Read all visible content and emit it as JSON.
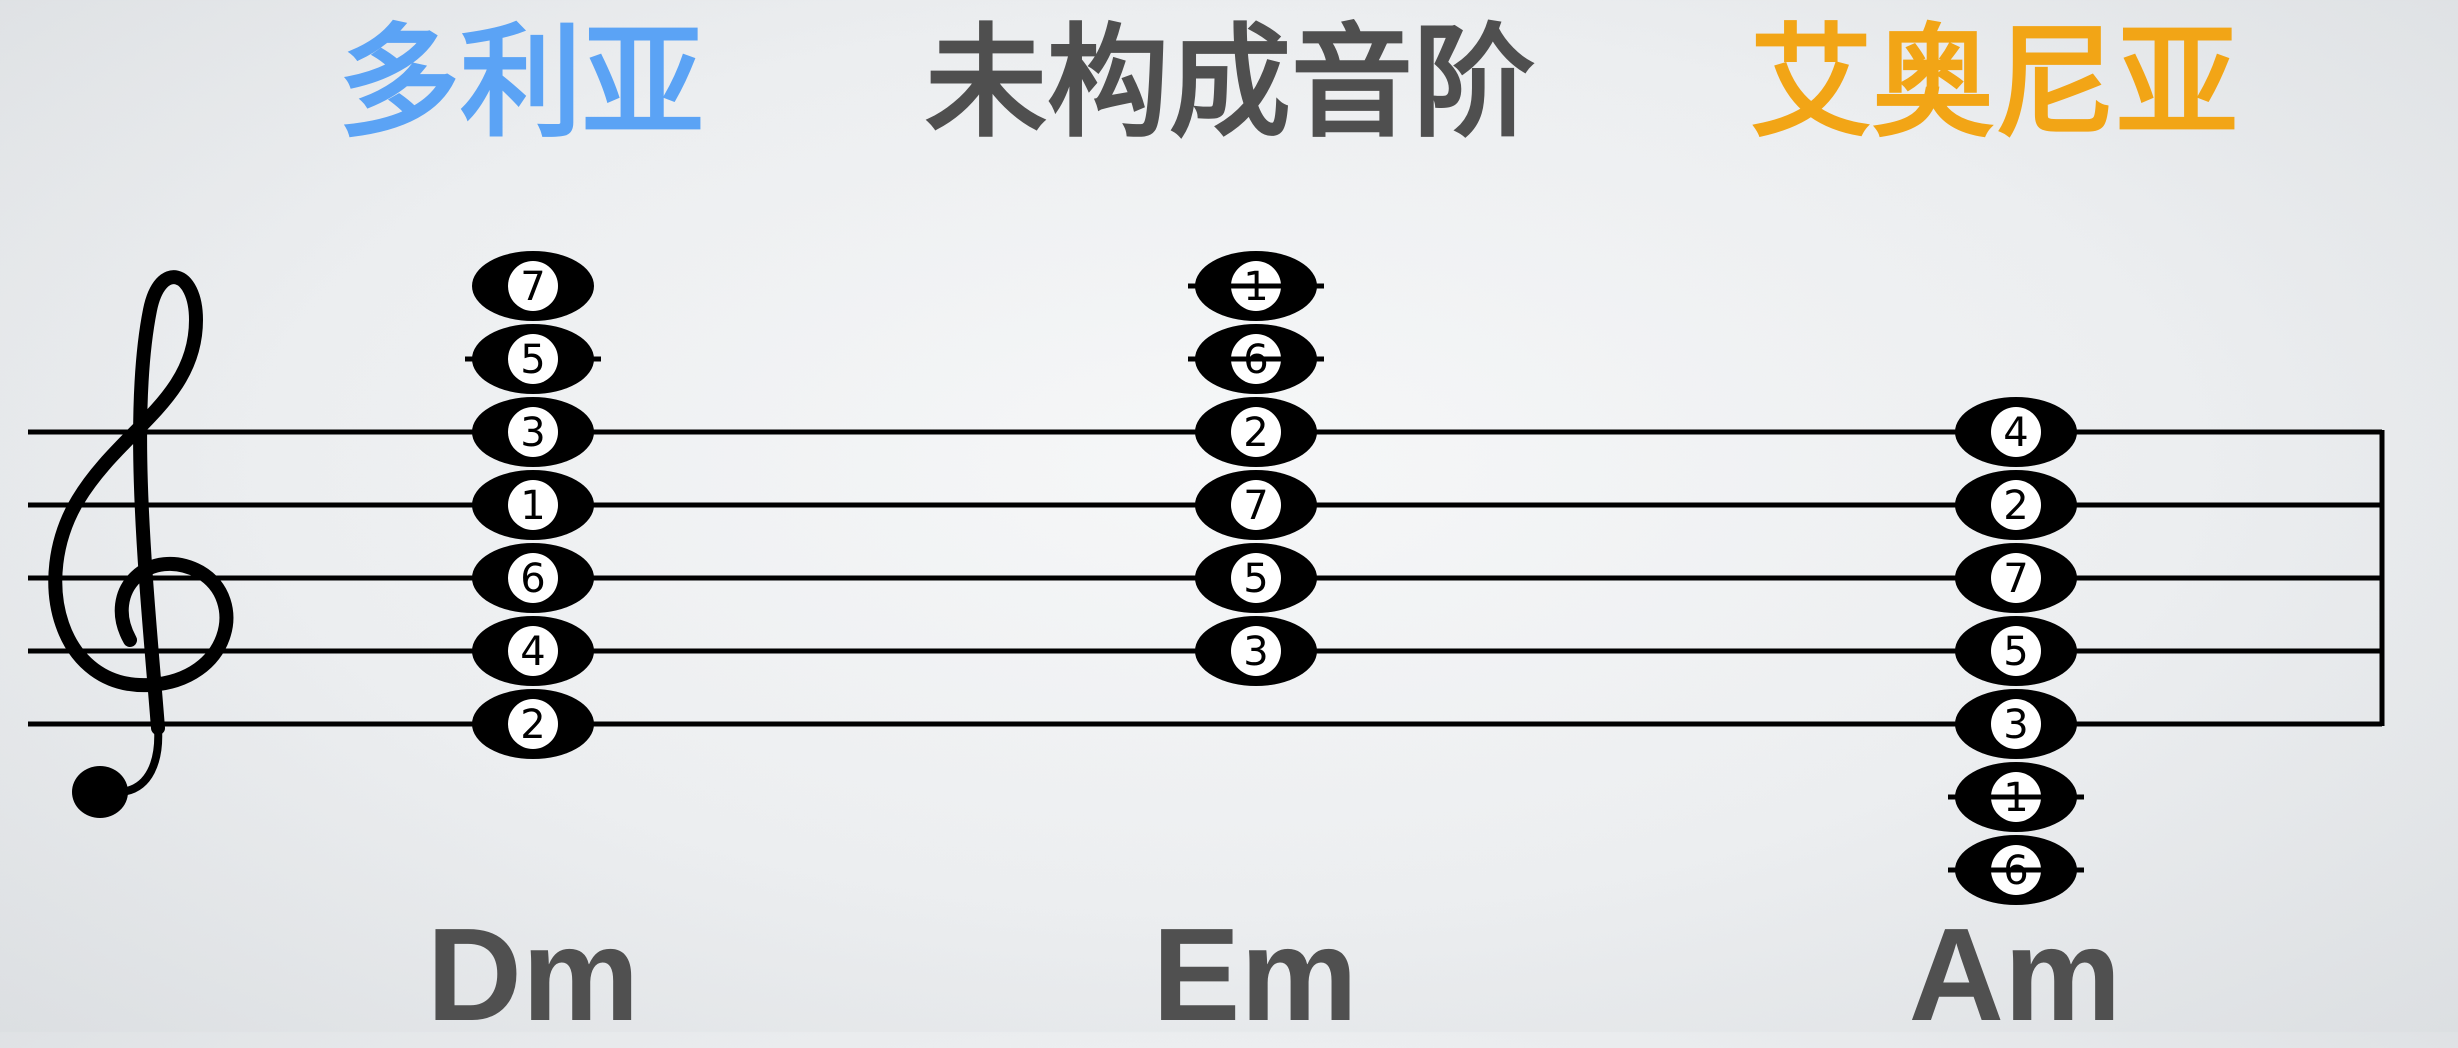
{
  "headings": {
    "left": {
      "text": "多利亚",
      "color": "#5ba3f5"
    },
    "middle": {
      "text": "未构成音阶",
      "color": "#4f4f4f"
    },
    "right": {
      "text": "艾奥尼亚",
      "color": "#f2a516"
    }
  },
  "clef": "treble-clef-icon",
  "chords": [
    {
      "name": "Dm",
      "notes": [
        {
          "degree": "7",
          "pitch": "C6",
          "ledger": false
        },
        {
          "degree": "5",
          "pitch": "A5",
          "ledger": false
        },
        {
          "degree": "3",
          "pitch": "F5",
          "ledger": false
        },
        {
          "degree": "1",
          "pitch": "D5",
          "ledger": false
        },
        {
          "degree": "6",
          "pitch": "B4",
          "ledger": false
        },
        {
          "degree": "4",
          "pitch": "G4",
          "ledger": false
        },
        {
          "degree": "2",
          "pitch": "E4",
          "ledger": false
        }
      ],
      "ledger_lines": [
        "A5"
      ]
    },
    {
      "name": "Em",
      "notes": [
        {
          "degree": "1",
          "pitch": "C6",
          "ledger": true
        },
        {
          "degree": "6",
          "pitch": "A5",
          "ledger": true
        },
        {
          "degree": "2",
          "pitch": "F5",
          "ledger": false
        },
        {
          "degree": "7",
          "pitch": "D5",
          "ledger": false
        },
        {
          "degree": "5",
          "pitch": "B4",
          "ledger": false
        },
        {
          "degree": "3",
          "pitch": "G4",
          "ledger": false
        }
      ],
      "ledger_lines": [
        "C6",
        "A5"
      ]
    },
    {
      "name": "Am",
      "notes": [
        {
          "degree": "4",
          "pitch": "F5",
          "ledger": false
        },
        {
          "degree": "2",
          "pitch": "D5",
          "ledger": false
        },
        {
          "degree": "7",
          "pitch": "B4",
          "ledger": false
        },
        {
          "degree": "5",
          "pitch": "G4",
          "ledger": false
        },
        {
          "degree": "3",
          "pitch": "E4",
          "ledger": false
        },
        {
          "degree": "1",
          "pitch": "C4",
          "ledger": true
        },
        {
          "degree": "6",
          "pitch": "A3",
          "ledger": true
        }
      ],
      "ledger_lines": [
        "C4",
        "A3"
      ]
    }
  ]
}
